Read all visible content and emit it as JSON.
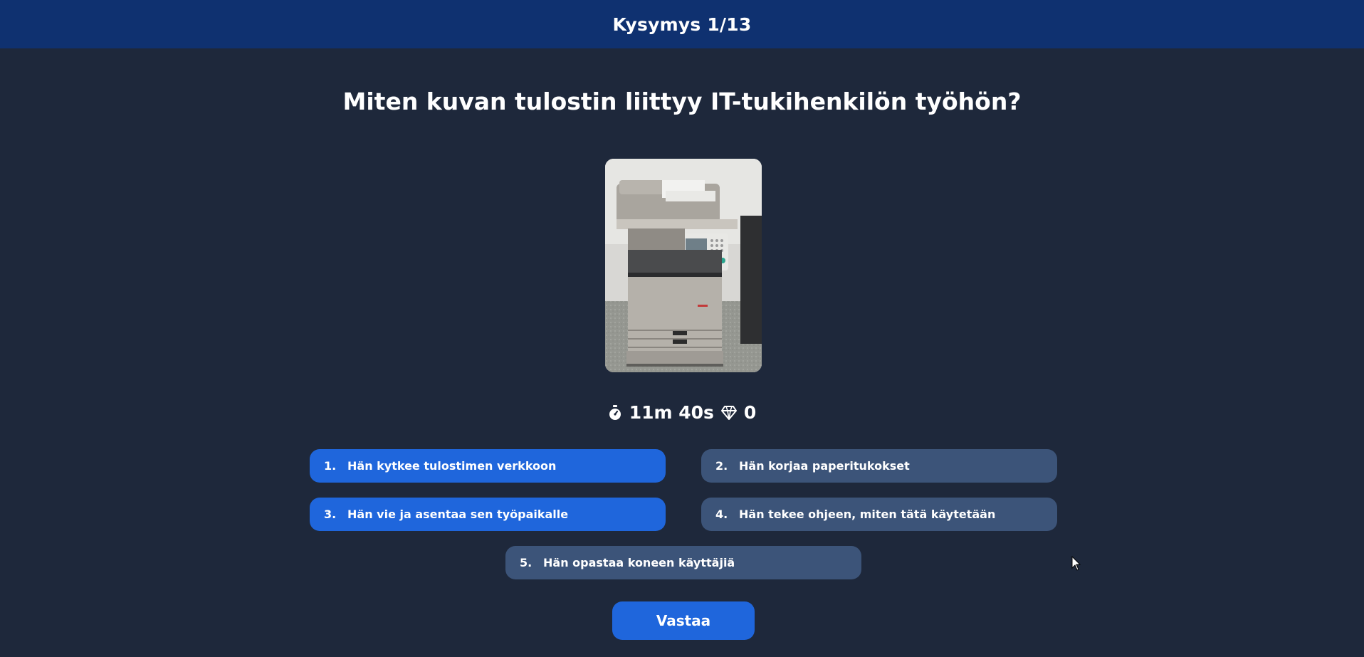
{
  "header": {
    "title": "Kysymys 1/13"
  },
  "question": {
    "text": "Miten kuvan tulostin liittyy IT-tukihenkilön työhön?",
    "image_icon": "printer-photo"
  },
  "stats": {
    "timer_icon": "stopwatch-icon",
    "timer": "11m 40s",
    "score_icon": "diamond-icon",
    "score": "0"
  },
  "answers": [
    {
      "num": "1.",
      "label": "Hän kytkee tulostimen verkkoon",
      "selected": true
    },
    {
      "num": "2.",
      "label": "Hän korjaa paperitukokset",
      "selected": false
    },
    {
      "num": "3.",
      "label": "Hän vie ja asentaa sen työpaikalle",
      "selected": true
    },
    {
      "num": "4.",
      "label": "Hän tekee ohjeen, miten tätä käytetään",
      "selected": false
    },
    {
      "num": "5.",
      "label": "Hän opastaa koneen käyttäjiä",
      "selected": false
    }
  ],
  "submit": {
    "label": "Vastaa"
  },
  "colors": {
    "background": "#1e283b",
    "header": "#0f3170",
    "selected": "#1f66dc",
    "unselected": "#3c5479"
  }
}
